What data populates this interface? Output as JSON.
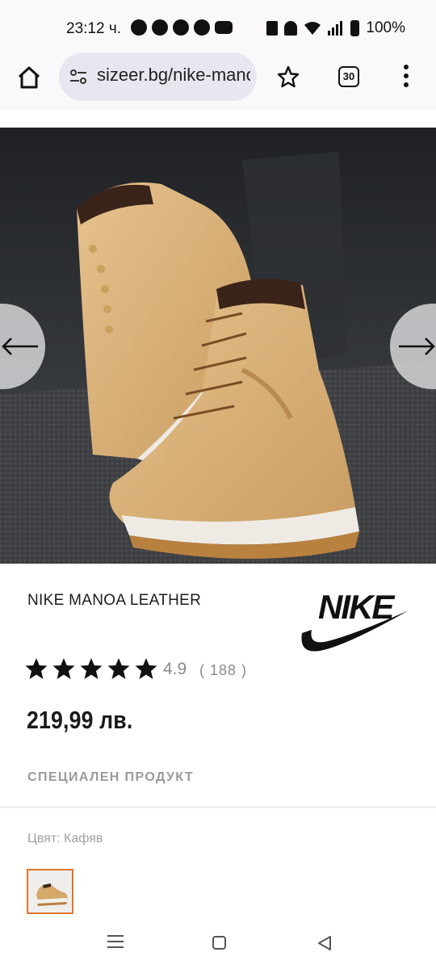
{
  "status_bar": {
    "time": "23:12 ч.",
    "left_icons": [
      "viber-icon",
      "whatsapp-icon",
      "chat-icon",
      "messenger-icon",
      "youtube-icon"
    ],
    "right_icons": [
      "nfc-icon",
      "mute-icon",
      "wifi-icon",
      "signal-icon",
      "battery-icon"
    ],
    "battery": "100%"
  },
  "browser": {
    "url": "sizeer.bg/nike-manoa",
    "tab_count": "30"
  },
  "product": {
    "title": "NIKE MANOA LEATHER",
    "brand": "Nike",
    "rating_value": "4.9",
    "rating_count": "( 188 )",
    "stars": 5,
    "price": "219,99 лв.",
    "special": "СПЕЦИАЛЕН ПРОДУКТ",
    "color_label": "Цвят: Кафяв"
  },
  "colors": {
    "accent": "#e0762c",
    "suede": "#d9b57f",
    "sole": "#efebe4"
  }
}
